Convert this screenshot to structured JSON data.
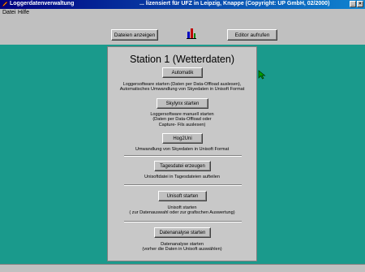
{
  "window": {
    "title": "Loggerdatenverwaltung",
    "license": "... lizensiert für UFZ in Leipzig, Knappe (Copyright: UP GmbH, 02/2000)",
    "min_label": "_",
    "close_label": "×"
  },
  "menu": [
    {
      "label": "Datei"
    },
    {
      "label": "Hilfe"
    }
  ],
  "toolbar": {
    "show_files_label": "Dateien anzeigen",
    "editor_label": "Editor aufrufen"
  },
  "panel": {
    "title": "Station 1 (Wetterdaten)",
    "sections": [
      {
        "button": "Automatik",
        "desc": [
          "Loggersoftware starten (Daten per Data-Offload auslesen),",
          "Automatisches Umwandlung von Skyedaten in Unisoft Format"
        ]
      },
      {
        "button": "Skylynx starten",
        "desc": [
          "Loggersoftware manuell starten",
          "(Daten per Data-Offload oder",
          "Capture- Fils auslesen)"
        ]
      },
      {
        "button": "Hog2Uni",
        "desc": [
          "Umwandlung von Skyedaten in Unisoft Format"
        ]
      },
      {
        "button": "Tagesdatei erzeugen",
        "desc": [
          "Unisoftdatei in Tagesdateien aufteilen"
        ]
      },
      {
        "button": "Unisoft starten",
        "desc": [
          "Unisoft starten",
          "( zur Datenauswahl oder zur grafischen Auswertung)"
        ]
      },
      {
        "button": "Datenanalyse starten",
        "desc": [
          "Datenanalyse starten",
          "(vorher die Daten in Unisoft auswählen)"
        ]
      }
    ]
  },
  "colors": {
    "desktop": "#1a9a8c",
    "titlebar": "#000080",
    "face": "#c0c0c0"
  }
}
